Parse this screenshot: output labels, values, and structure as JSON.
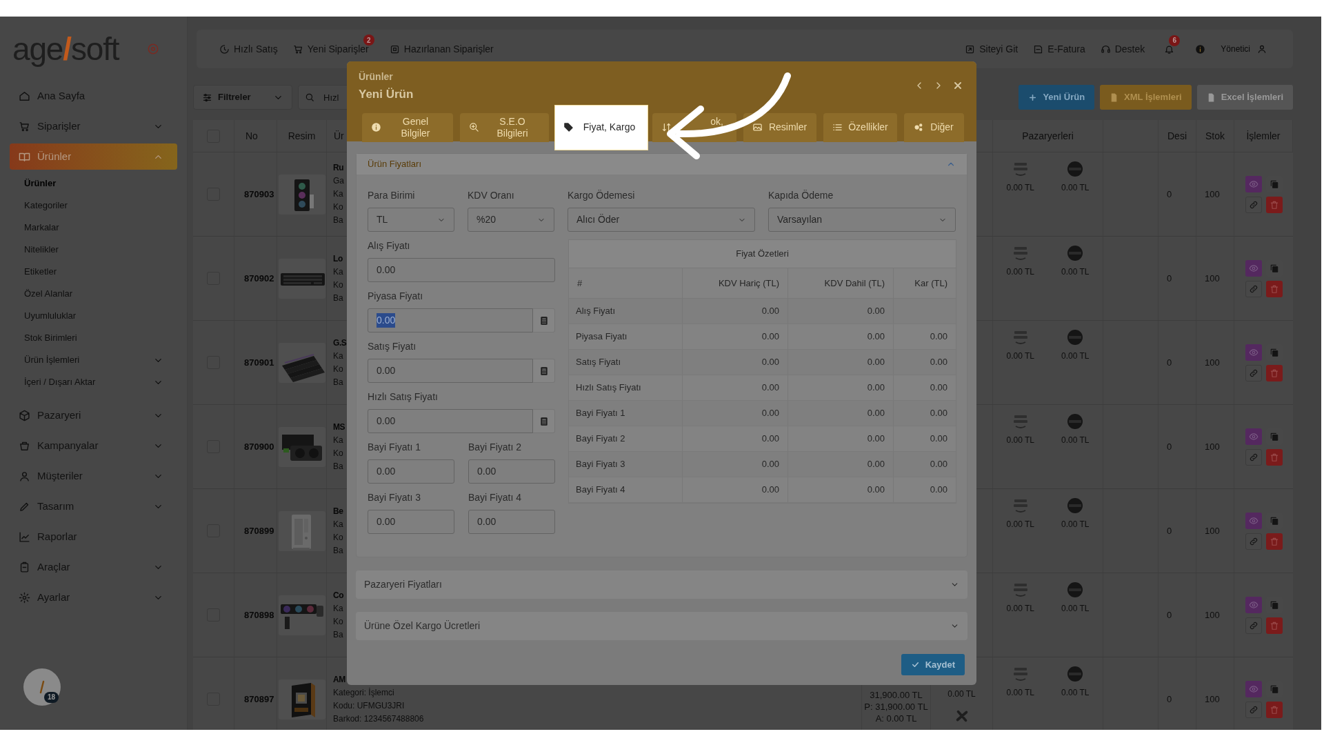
{
  "logo": [
    "age",
    "/",
    "soft"
  ],
  "sidebar": {
    "items": [
      {
        "label": "Ana Sayfa",
        "selected": false
      },
      {
        "label": "Siparişler",
        "selected": false,
        "expanded": false
      },
      {
        "label": "Ürünler",
        "selected": true,
        "expanded": true,
        "children": [
          {
            "label": "Ürünler",
            "selected": true
          },
          {
            "label": "Kategoriler",
            "selected": false
          },
          {
            "label": "Markalar",
            "selected": false
          },
          {
            "label": "Nitelikler",
            "selected": false
          },
          {
            "label": "Etiketler",
            "selected": false
          },
          {
            "label": "Özel Alanlar",
            "selected": false
          },
          {
            "label": "Uyumluluklar",
            "selected": false
          },
          {
            "label": "Stok Birimleri",
            "selected": false
          },
          {
            "label": "Ürün İşlemleri",
            "selected": false,
            "expanded": false
          },
          {
            "label": "İçeri / Dışarı Aktar",
            "selected": false,
            "expanded": false
          }
        ]
      },
      {
        "label": "Pazaryeri",
        "selected": false,
        "expanded": false
      },
      {
        "label": "Kampanyalar",
        "selected": false,
        "expanded": false
      },
      {
        "label": "Müşteriler",
        "selected": false,
        "expanded": false
      },
      {
        "label": "Tasarım",
        "selected": false,
        "expanded": false
      },
      {
        "label": "Raporlar",
        "selected": false
      },
      {
        "label": "Araçlar",
        "selected": false,
        "expanded": false
      },
      {
        "label": "Ayarlar",
        "selected": false,
        "expanded": false
      }
    ],
    "avatar_badge": "18"
  },
  "topbar": {
    "left": [
      {
        "label": "Hızlı Satış"
      },
      {
        "label": "Yeni Siparişler",
        "badge": "2"
      },
      {
        "label": "Hazırlanan Siparişler"
      }
    ],
    "right": [
      {
        "label": "Siteyi Git"
      },
      {
        "label": "E-Fatura"
      },
      {
        "label": "Destek"
      }
    ],
    "notifications_badge": "6",
    "user": "Yönetici"
  },
  "toolbar": {
    "filter": "Filtreler",
    "search": {
      "placeholder": "Hızl"
    },
    "buttons": [
      {
        "label": "Yeni Ürün",
        "kind": "primary"
      },
      {
        "label": "XML İşlemleri",
        "kind": "warning"
      },
      {
        "label": "Excel İşlemleri",
        "kind": "secondary"
      }
    ]
  },
  "table": {
    "columns": [
      "No",
      "Resim",
      "Ür",
      "Pazaryerleri",
      "Desi",
      "Stok",
      "İşlemler"
    ],
    "all_checked": false,
    "rows": [
      {
        "checked": false,
        "no": "870903",
        "product": [
          "Ru",
          "Ga",
          "Ka",
          "Ko",
          "Ba"
        ],
        "marketplaces": [
          "0.00 TL",
          "0.00 TL"
        ],
        "desi": "0",
        "stock": "100"
      },
      {
        "checked": false,
        "no": "870902",
        "product": [
          "Lo",
          "Ka",
          "Ko",
          "Ba"
        ],
        "marketplaces": [
          "0.00 TL",
          "0.00 TL"
        ],
        "desi": "0",
        "stock": "100"
      },
      {
        "checked": false,
        "no": "870901",
        "product": [
          "G.S",
          "Ka",
          "Ko",
          "Ba"
        ],
        "marketplaces": [
          "0.00 TL",
          "0.00 TL"
        ],
        "desi": "0",
        "stock": "100"
      },
      {
        "checked": false,
        "no": "870900",
        "product": [
          "MS",
          "Ka",
          "Ko",
          "Ba"
        ],
        "marketplaces": [
          "0.00 TL",
          "0.00 TL"
        ],
        "desi": "0",
        "stock": "100"
      },
      {
        "checked": false,
        "no": "870899",
        "product": [
          "Be",
          "Ka",
          "Ko",
          "Ba"
        ],
        "marketplaces": [
          "0.00 TL",
          "0.00 TL"
        ],
        "desi": "0",
        "stock": "100"
      },
      {
        "checked": false,
        "no": "870898",
        "product": [
          "Co",
          "Ka",
          "Ko",
          "Ba"
        ],
        "marketplaces": [
          "0.00 TL",
          "0.00 TL"
        ],
        "desi": "0",
        "stock": "100"
      },
      {
        "checked": false,
        "no": "870897",
        "product": [
          "AM",
          "Kategori: İşlemci",
          "Kodu: UFMGU3JRI",
          "Barkod: 1234567488806"
        ],
        "prices": [
          "31,900.00 TL",
          "P: 31,900.00 TL",
          "A: 0.00 TL"
        ],
        "column_6": "0.00 TL",
        "marketplaces": [
          "0.00 TL",
          "0.00 TL"
        ],
        "desi": "0",
        "stock": "100"
      }
    ]
  },
  "modal": {
    "breadcrumb": "Ürünler",
    "title": "Yeni Ürün",
    "tabs": [
      {
        "label": "Genel Bilgiler",
        "selected": false
      },
      {
        "label": "S.E.O Bilgileri",
        "selected": false
      },
      {
        "label": "Fiyat, Kargo",
        "selected": true
      },
      {
        "label": "ok,",
        "selected": false
      },
      {
        "label": "Resimler",
        "selected": false
      },
      {
        "label": "Özellikler",
        "selected": false
      },
      {
        "label": "Diğer",
        "selected": false
      }
    ],
    "section": {
      "title": "Ürün Fiyatları",
      "expanded": true,
      "selects": [
        {
          "label": "Para Birimi",
          "value": "TL"
        },
        {
          "label": "KDV Oranı",
          "value": "%20"
        },
        {
          "label": "Kargo Ödemesi",
          "value": "Alıcı Öder"
        },
        {
          "label": "Kapıda Ödeme",
          "value": "Varsayılan"
        }
      ],
      "fields": [
        {
          "label": "Alış Fiyatı",
          "value": "0.00",
          "kind": "full",
          "focused": false
        },
        {
          "label": "Piyasa Fiyatı",
          "value": "0.00",
          "kind": "calc",
          "focused": true
        },
        {
          "label": "Satış Fiyatı",
          "value": "0.00",
          "kind": "calc",
          "focused": false
        },
        {
          "label": "Hızlı Satış Fiyatı",
          "value": "0.00",
          "kind": "calc",
          "focused": false
        },
        {
          "label": "Bayi Fiyatı 1",
          "value": "0.00",
          "kind": "half",
          "focused": false
        },
        {
          "label": "Bayi Fiyatı 2",
          "value": "0.00",
          "kind": "half",
          "focused": false
        },
        {
          "label": "Bayi Fiyatı 3",
          "value": "0.00",
          "kind": "half",
          "focused": false
        },
        {
          "label": "Bayi Fiyatı 4",
          "value": "0.00",
          "kind": "half",
          "focused": false
        }
      ],
      "summary": {
        "title": "Fiyat Özetleri",
        "columns": [
          "#",
          "KDV Hariç (TL)",
          "KDV Dahil (TL)",
          "Kar (TL)"
        ],
        "rows": [
          {
            "label": "Alış Fiyatı",
            "values": [
              "0.00",
              "0.00"
            ]
          },
          {
            "label": "Piyasa Fiyatı",
            "values": [
              "0.00",
              "0.00",
              "0.00"
            ]
          },
          {
            "label": "Satış Fiyatı",
            "values": [
              "0.00",
              "0.00",
              "0.00"
            ]
          },
          {
            "label": "Hızlı Satış Fiyatı",
            "values": [
              "0.00",
              "0.00",
              "0.00"
            ]
          },
          {
            "label": "Bayi Fiyatı 1",
            "values": [
              "0.00",
              "0.00",
              "0.00"
            ]
          },
          {
            "label": "Bayi Fiyatı 2",
            "values": [
              "0.00",
              "0.00",
              "0.00"
            ]
          },
          {
            "label": "Bayi Fiyatı 3",
            "values": [
              "0.00",
              "0.00",
              "0.00"
            ]
          },
          {
            "label": "Bayi Fiyatı 4",
            "values": [
              "0.00",
              "0.00",
              "0.00"
            ]
          }
        ]
      }
    },
    "accordions": [
      {
        "title": "Pazaryeri Fiyatları",
        "expanded": false
      },
      {
        "title": "Ürüne Özel Kargo Ücretleri",
        "expanded": false
      }
    ],
    "save": "Kaydet"
  }
}
